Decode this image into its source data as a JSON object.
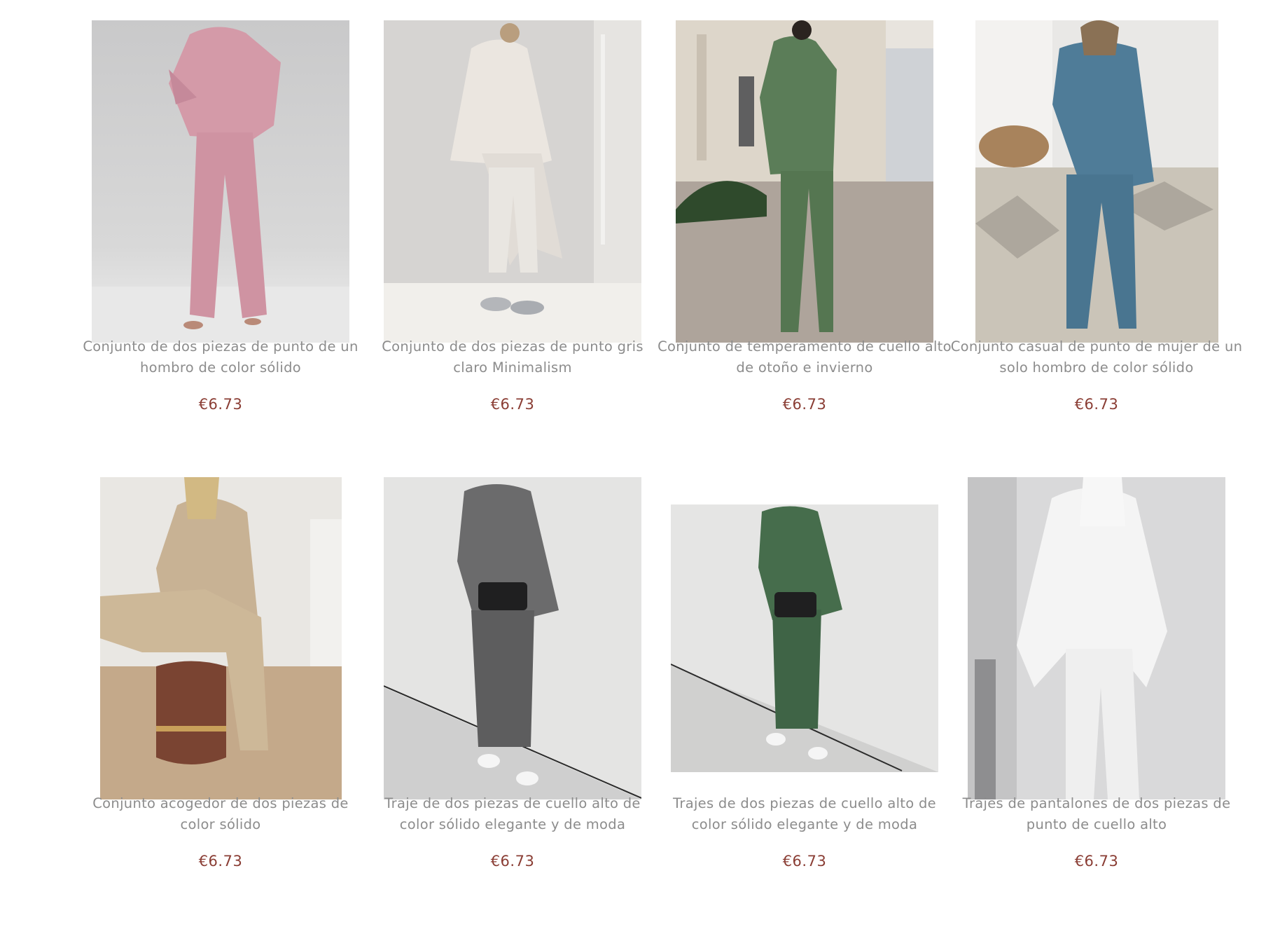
{
  "colors": {
    "title": "#8c8c8c",
    "price": "#8a3d34",
    "background": "#ffffff"
  },
  "products": [
    {
      "title": "Conjunto de dos piezas de punto de un hombro de color sólido",
      "price": "€6.73",
      "image_icon": "pink-knit-set-photo"
    },
    {
      "title": "Conjunto de dos piezas de punto gris claro Minimalism",
      "price": "€6.73",
      "image_icon": "light-grey-knit-set-photo"
    },
    {
      "title": "Conjunto de temperamento de cuello alto de otoño e invierno",
      "price": "€6.73",
      "image_icon": "green-turtleneck-set-photo"
    },
    {
      "title": "Conjunto casual de punto de mujer de un solo hombro de color sólido",
      "price": "€6.73",
      "image_icon": "blue-knit-set-photo"
    },
    {
      "title": "Conjunto acogedor de dos piezas de color sólido",
      "price": "€6.73",
      "image_icon": "beige-knit-set-photo"
    },
    {
      "title": "Traje de dos piezas de cuello alto de color sólido elegante y de moda",
      "price": "€6.73",
      "image_icon": "grey-sweater-skirt-photo"
    },
    {
      "title": "Trajes de dos piezas de cuello alto de color sólido elegante y de moda",
      "price": "€6.73",
      "image_icon": "green-sweater-skirt-photo"
    },
    {
      "title": "Trajes de pantalones de dos piezas de punto de cuello alto",
      "price": "€6.73",
      "image_icon": "white-turtleneck-set-photo"
    }
  ]
}
